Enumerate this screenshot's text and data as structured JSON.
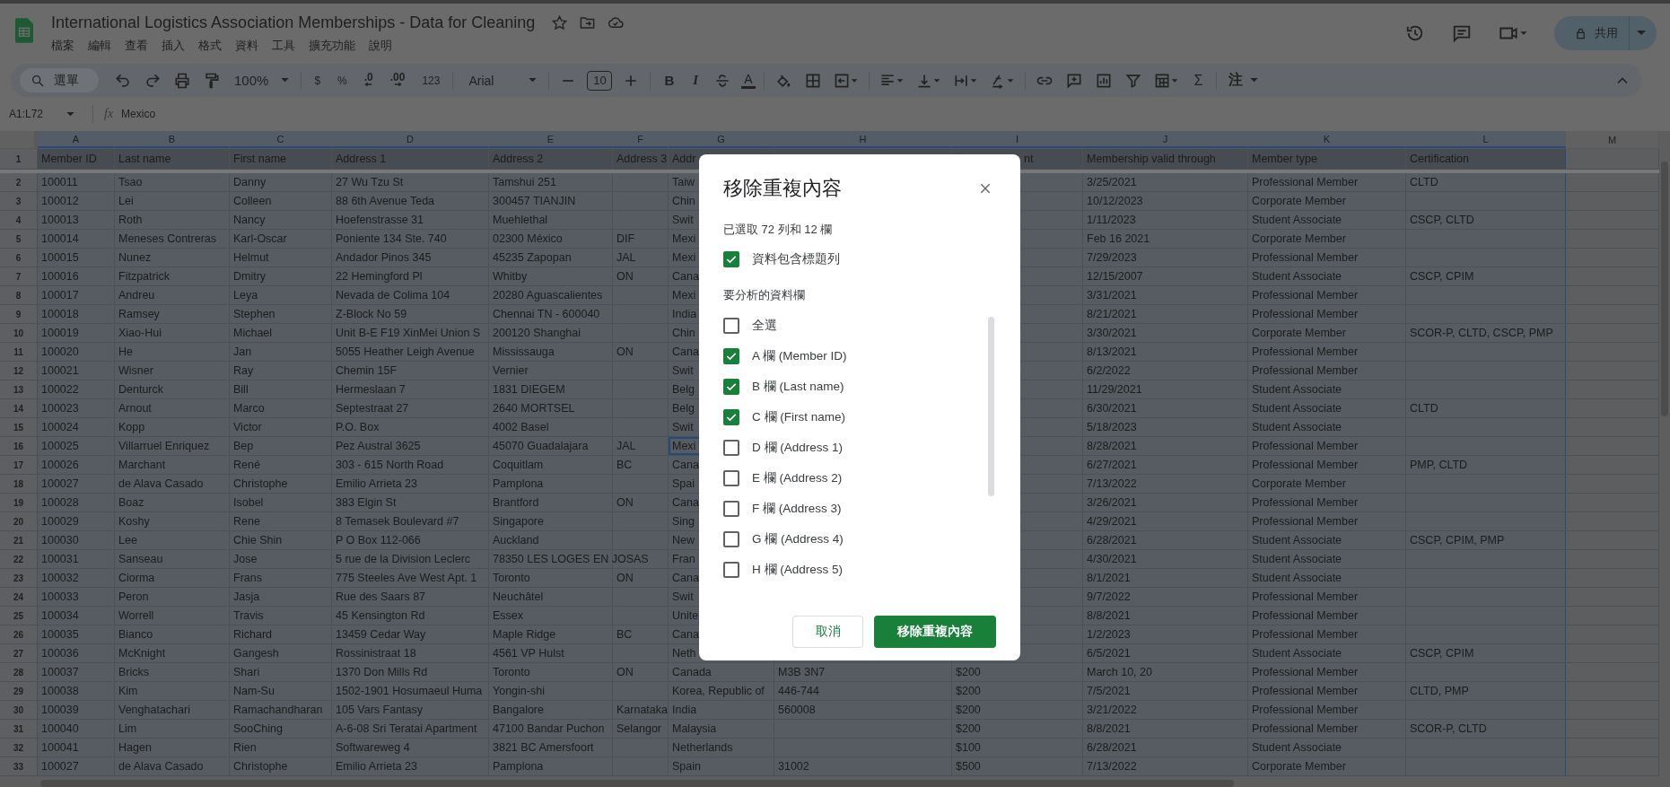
{
  "document": {
    "title": "International Logistics Association Memberships - Data for Cleaning",
    "menu": [
      "檔案",
      "編輯",
      "查看",
      "插入",
      "格式",
      "資料",
      "工具",
      "擴充功能",
      "說明"
    ]
  },
  "share_button": {
    "label": "共用"
  },
  "toolbar": {
    "search": "選單",
    "zoom": "100%",
    "currency": "$",
    "percent": "%",
    "decrease_decimals": ".0",
    "increase_decimals": ".00",
    "number_format": "123",
    "font": "Arial",
    "font_size": "10",
    "bold": "B",
    "italic": "I",
    "text_color": "A",
    "functions": "Σ",
    "input_tools": "注"
  },
  "formula_bar": {
    "name_box": "A1:L72",
    "label": "fx",
    "value": "Mexico"
  },
  "sheet": {
    "columns": [
      {
        "label": "A",
        "selected": true
      },
      {
        "label": "B",
        "selected": true
      },
      {
        "label": "C",
        "selected": true
      },
      {
        "label": "D",
        "selected": true
      },
      {
        "label": "E",
        "selected": true
      },
      {
        "label": "F",
        "selected": true
      },
      {
        "label": "G",
        "selected": true
      },
      {
        "label": "H",
        "selected": true
      },
      {
        "label": "I",
        "selected": true
      },
      {
        "label": "J",
        "selected": true
      },
      {
        "label": "K",
        "selected": true
      },
      {
        "label": "L",
        "selected": true
      },
      {
        "label": "M",
        "selected": false
      }
    ],
    "rows": [
      {
        "number": "1",
        "kind": "header",
        "cells": [
          "Member ID",
          "Last name",
          "First name",
          "Address 1",
          "Address 2",
          "Address 3",
          "Addr",
          null,
          {
            "text": "nt",
            "cut": true
          },
          "Membership valid through",
          "Member type",
          "Certification"
        ]
      },
      {
        "number": "2",
        "kind": "data",
        "cells": [
          "100011",
          "Tsao",
          "Danny",
          "27 Wu Tzu St",
          "Tamshui 251",
          null,
          "Taiw",
          null,
          null,
          "3/25/2021",
          "Professional Member",
          "CLTD"
        ]
      },
      {
        "number": "3",
        "kind": "data",
        "cells": [
          "100012",
          "Lei",
          "Colleen",
          "88 6th Avenue Teda",
          "300457 TIANJIN",
          null,
          "Chin",
          null,
          null,
          "10/12/2023",
          "Corporate Member",
          null
        ]
      },
      {
        "number": "4",
        "kind": "data",
        "cells": [
          "100013",
          "Roth",
          "Nancy",
          "Hoefenstrasse 31",
          "Muehlethal",
          null,
          "Swit",
          null,
          null,
          "1/11/2023",
          "Student Associate",
          "CSCP, CLTD"
        ]
      },
      {
        "number": "5",
        "kind": "data",
        "cells": [
          "100014",
          "Meneses Contreras",
          "Karl-Oscar",
          "Poniente 134 Ste. 740",
          "02300 México",
          "DIF",
          "Mexi",
          null,
          null,
          "Feb 16 2021",
          "Corporate Member",
          null
        ]
      },
      {
        "number": "6",
        "kind": "data",
        "cells": [
          "100015",
          "Nunez",
          "Helmut",
          "Andador Pinos 345",
          "45235 Zapopan",
          "JAL",
          "Mexi",
          null,
          null,
          "7/29/2023",
          "Professional Member",
          null
        ]
      },
      {
        "number": "7",
        "kind": "data",
        "cells": [
          "100016",
          "Fitzpatrick",
          "Dmitry",
          "22 Hemingford Pl",
          "Whitby",
          "ON",
          "Cana",
          null,
          null,
          "12/15/2007",
          "Student Associate",
          "CSCP, CPIM"
        ]
      },
      {
        "number": "8",
        "kind": "data",
        "cells": [
          "100017",
          "Andreu",
          "Leya",
          "Nevada de Colima 104",
          "20280 Aguascalientes",
          null,
          "Mexi",
          null,
          null,
          "3/31/2021",
          "Professional Member",
          null
        ]
      },
      {
        "number": "9",
        "kind": "data",
        "cells": [
          "100018",
          "Ramsey",
          "Stephen",
          "Z-Block No 59",
          "Chennai TN - 600040",
          null,
          "India",
          null,
          null,
          "8/21/2021",
          "Professional Member",
          null
        ]
      },
      {
        "number": "10",
        "kind": "data",
        "cells": [
          "100019",
          "Xiao-Hui",
          "Michael",
          "Unit B-E F19 XinMei Union S",
          "200120 Shanghai",
          null,
          "Chin",
          null,
          null,
          "3/30/2021",
          "Corporate Member",
          "SCOR-P, CLTD, CSCP, PMP"
        ]
      },
      {
        "number": "11",
        "kind": "data",
        "cells": [
          "100020",
          "He",
          "Jan",
          "5055 Heather Leigh Avenue",
          "Mississauga",
          "ON",
          "Cana",
          null,
          null,
          "8/13/2021",
          "Professional Member",
          null
        ]
      },
      {
        "number": "12",
        "kind": "data",
        "cells": [
          "100021",
          "Wisner",
          "Ray",
          "Chemin 15F",
          "Vernier",
          null,
          "Swit",
          null,
          null,
          "6/2/2022",
          "Professional Member",
          null
        ]
      },
      {
        "number": "13",
        "kind": "data",
        "cells": [
          "100022",
          "Denturck",
          "Bill",
          "Hermeslaan 7",
          "1831 DIEGEM",
          null,
          "Belg",
          null,
          null,
          "11/29/2021",
          "Student Associate",
          null
        ]
      },
      {
        "number": "14",
        "kind": "data",
        "cells": [
          "100023",
          "Arnout",
          "Marco",
          "Septestraat 27",
          "2640 MORTSEL",
          null,
          "Belg",
          null,
          null,
          "6/30/2021",
          "Student Associate",
          "CLTD"
        ]
      },
      {
        "number": "15",
        "kind": "data",
        "cells": [
          "100024",
          "Kopp",
          "Victor",
          "P.O. Box",
          "4002 Basel",
          null,
          "Swit",
          null,
          null,
          "5/18/2023",
          "Student Associate",
          null
        ]
      },
      {
        "number": "16",
        "kind": "data",
        "cells": [
          "100025",
          "Villarruel Enriquez",
          "Bep",
          "Pez Austral 3625",
          "45070 Guadalajara",
          "JAL",
          {
            "text": "Mexi",
            "selected": true
          },
          null,
          null,
          "8/28/2021",
          "Professional Member",
          null
        ]
      },
      {
        "number": "17",
        "kind": "data",
        "cells": [
          "100026",
          "Marchant",
          "René",
          "303 - 615 North Road",
          "Coquitlam",
          "BC",
          "Cana",
          null,
          null,
          "6/27/2021",
          "Professional Member",
          "PMP, CLTD"
        ]
      },
      {
        "number": "18",
        "kind": "data",
        "cells": [
          "100027",
          "de Alava Casado",
          "Christophe",
          "Emilio Arrieta 23",
          "Pamplona",
          null,
          "Spai",
          null,
          null,
          "7/13/2022",
          "Corporate Member",
          null
        ]
      },
      {
        "number": "19",
        "kind": "data",
        "cells": [
          "100028",
          "Boaz",
          "Isobel",
          "383 Elgin St",
          "Brantford",
          "ON",
          "Cana",
          null,
          null,
          "3/26/2021",
          "Professional Member",
          null
        ]
      },
      {
        "number": "20",
        "kind": "data",
        "cells": [
          "100029",
          "Koshy",
          "Rene",
          "8 Temasek Boulevard #7",
          "Singapore",
          null,
          "Sing",
          null,
          null,
          "4/29/2021",
          "Professional Member",
          null
        ]
      },
      {
        "number": "21",
        "kind": "data",
        "cells": [
          "100030",
          "Lee",
          "Chie Shin",
          "P O Box 112-066",
          "Auckland",
          null,
          "New",
          null,
          null,
          "6/28/2021",
          "Student Associate",
          "CSCP, CPIM, PMP"
        ]
      },
      {
        "number": "22",
        "kind": "data",
        "cells": [
          "100031",
          "Sanseau",
          "Jose",
          "5 rue de la Division Leclerc",
          "78350 LES LOGES EN JOSAS",
          null,
          "Fran",
          null,
          null,
          "4/30/2021",
          "Student Associate",
          null
        ]
      },
      {
        "number": "23",
        "kind": "data",
        "cells": [
          "100032",
          "Ciorma",
          "Frans",
          "775 Steeles Ave West Apt. 1",
          "Toronto",
          "ON",
          "Cana",
          null,
          null,
          "8/1/2021",
          "Student Associate",
          null
        ]
      },
      {
        "number": "24",
        "kind": "data",
        "cells": [
          "100033",
          "Peron",
          "Jasja",
          "Rue des Saars 87",
          "Neuchâtel",
          null,
          "Swit",
          null,
          null,
          "9/7/2022",
          "Professional Member",
          null
        ]
      },
      {
        "number": "25",
        "kind": "data",
        "cells": [
          "100034",
          "Worrell",
          "Travis",
          "45 Kensington Rd",
          "Essex",
          null,
          "Unite",
          null,
          null,
          "8/8/2021",
          "Professional Member",
          null
        ]
      },
      {
        "number": "26",
        "kind": "data",
        "cells": [
          "100035",
          "Bianco",
          "Richard",
          "13459 Cedar Way",
          "Maple Ridge",
          "BC",
          "Cana",
          null,
          null,
          "1/2/2023",
          "Professional Member",
          null
        ]
      },
      {
        "number": "27",
        "kind": "data",
        "cells": [
          "100036",
          "McKnight",
          "Gangesh",
          "Rossinistraat 18",
          "4561 VP Hulst",
          null,
          "Neth",
          null,
          null,
          "6/5/2021",
          "Student Associate",
          "CSCP, CPIM"
        ]
      },
      {
        "number": "28",
        "kind": "data",
        "cells": [
          "100037",
          "Bricks",
          "Shari",
          "1370 Don Mills Rd",
          "Toronto",
          "ON",
          "Canada",
          "M3B 3N7",
          "$200",
          "March 10, 20",
          "Professional Member",
          null
        ]
      },
      {
        "number": "29",
        "kind": "data",
        "cells": [
          "100038",
          "Kim",
          "Nam-Su",
          "1502-1901 Hosumaeul Huma",
          "Yongin-shi",
          null,
          "Korea, Republic of",
          "446-744",
          "$200",
          "7/5/2021",
          "Professional Member",
          "CLTD, PMP"
        ]
      },
      {
        "number": "30",
        "kind": "data",
        "cells": [
          "100039",
          "Venghatachari",
          "Ramachandharan",
          "105 Vars Fantasy",
          "Bangalore",
          "Karnataka",
          "India",
          "560008",
          "$200",
          "3/21/2022",
          "Professional Member",
          null
        ]
      },
      {
        "number": "31",
        "kind": "data",
        "cells": [
          "100040",
          "Lim",
          "SooChing",
          "A-6-08 Sri Teratai Apartment",
          "47100 Bandar Puchon",
          "Selangor",
          "Malaysia",
          null,
          "$200",
          "8/8/2021",
          "Professional Member",
          "SCOR-P, CLTD"
        ]
      },
      {
        "number": "32",
        "kind": "data",
        "cells": [
          "100041",
          "Hagen",
          "Rien",
          "Softwareweg 4",
          "3821 BC Amersfoort",
          null,
          "Netherlands",
          null,
          "$100",
          "6/28/2021",
          "Student Associate",
          null
        ]
      },
      {
        "number": "33",
        "kind": "data",
        "cells": [
          "100027",
          "de Alava Casado",
          "Christophe",
          "Emilio Arrieta 23",
          "Pamplona",
          null,
          "Spain",
          "31002",
          "$500",
          "7/13/2022",
          "Corporate Member",
          null
        ]
      }
    ]
  },
  "dialog": {
    "title": "移除重複內容",
    "summary": "已選取 72 列和 12 欄",
    "header_option": {
      "label": "資料包含標題列",
      "checked": true
    },
    "columns_label": "要分析的資料欄",
    "column_options": [
      {
        "label": "全選",
        "checked": false
      },
      {
        "label": "A 欄 (Member ID)",
        "checked": true
      },
      {
        "label": "B 欄 (Last name)",
        "checked": true
      },
      {
        "label": "C 欄 (First name)",
        "checked": true
      },
      {
        "label": "D 欄 (Address 1)",
        "checked": false
      },
      {
        "label": "E 欄 (Address 2)",
        "checked": false
      },
      {
        "label": "F 欄 (Address 3)",
        "checked": false
      },
      {
        "label": "G 欄 (Address 4)",
        "checked": false
      },
      {
        "label": "H 欄 (Address 5)",
        "checked": false
      }
    ],
    "buttons": [
      {
        "label": "取消",
        "kind": "secondary"
      },
      {
        "label": "移除重複內容",
        "kind": "primary"
      }
    ]
  }
}
